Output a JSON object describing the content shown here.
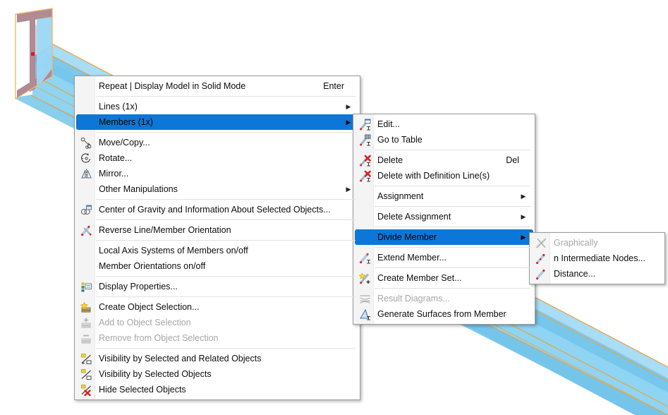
{
  "app": {
    "model_description": "3D structural model: blue I-beam member running diagonally with orange member outlines and a rose-colored I cross-section at the near end",
    "colors": {
      "highlight": "#0c77d8",
      "menu_background": "#ffffff",
      "gutter": "#f4f4f4",
      "separator": "#e2e2e2",
      "disabled_text": "#a6a6a6",
      "beam_face": "#8ed2f2",
      "beam_face_light": "#a9dcf5",
      "beam_face_dark": "#6ec0e8",
      "beam_edge": "#e8a33d",
      "section_fill": "#b08a94",
      "node_dot": "#e01b1b"
    }
  },
  "context_menu": {
    "items": [
      {
        "label": "Repeat | Display Model in Solid Mode",
        "accel": "Enter",
        "icon": "none",
        "submenu": false,
        "disabled": false,
        "selected": false
      },
      {
        "separator": true
      },
      {
        "label": "Lines (1x)",
        "accel": "",
        "icon": "none",
        "submenu": true,
        "disabled": false,
        "selected": false
      },
      {
        "label": "Members (1x)",
        "accel": "",
        "icon": "none",
        "submenu": true,
        "disabled": false,
        "selected": true
      },
      {
        "separator": true
      },
      {
        "label": "Move/Copy...",
        "accel": "",
        "icon": "move-copy-icon",
        "submenu": false,
        "disabled": false,
        "selected": false
      },
      {
        "label": "Rotate...",
        "accel": "",
        "icon": "rotate-icon",
        "submenu": false,
        "disabled": false,
        "selected": false
      },
      {
        "label": "Mirror...",
        "accel": "",
        "icon": "mirror-icon",
        "submenu": false,
        "disabled": false,
        "selected": false
      },
      {
        "label": "Other Manipulations",
        "accel": "",
        "icon": "none",
        "submenu": true,
        "disabled": false,
        "selected": false
      },
      {
        "separator": true
      },
      {
        "label": "Center of Gravity and Information About Selected Objects...",
        "accel": "",
        "icon": "center-of-gravity-icon",
        "submenu": false,
        "disabled": false,
        "selected": false
      },
      {
        "separator": true
      },
      {
        "label": "Reverse Line/Member Orientation",
        "accel": "",
        "icon": "reverse-orientation-icon",
        "submenu": false,
        "disabled": false,
        "selected": false
      },
      {
        "separator": true
      },
      {
        "label": "Local Axis Systems of Members on/off",
        "accel": "",
        "icon": "none",
        "submenu": false,
        "disabled": false,
        "selected": false
      },
      {
        "label": "Member Orientations on/off",
        "accel": "",
        "icon": "none",
        "submenu": false,
        "disabled": false,
        "selected": false
      },
      {
        "separator": true
      },
      {
        "label": "Display Properties...",
        "accel": "",
        "icon": "display-properties-icon",
        "submenu": false,
        "disabled": false,
        "selected": false
      },
      {
        "separator": true
      },
      {
        "label": "Create Object Selection...",
        "accel": "",
        "icon": "create-object-selection-icon",
        "submenu": false,
        "disabled": false,
        "selected": false
      },
      {
        "label": "Add to Object Selection",
        "accel": "",
        "icon": "add-to-object-selection-icon",
        "submenu": false,
        "disabled": true,
        "selected": false
      },
      {
        "label": "Remove from Object Selection",
        "accel": "",
        "icon": "remove-from-object-selection-icon",
        "submenu": false,
        "disabled": true,
        "selected": false
      },
      {
        "separator": true
      },
      {
        "label": "Visibility by Selected and Related Objects",
        "accel": "",
        "icon": "visibility-related-icon",
        "submenu": false,
        "disabled": false,
        "selected": false
      },
      {
        "label": "Visibility by Selected Objects",
        "accel": "",
        "icon": "visibility-selected-icon",
        "submenu": false,
        "disabled": false,
        "selected": false
      },
      {
        "label": "Hide Selected Objects",
        "accel": "",
        "icon": "hide-selected-icon",
        "submenu": false,
        "disabled": false,
        "selected": false
      }
    ]
  },
  "members_submenu": {
    "items": [
      {
        "label": "Edit...",
        "accel": "",
        "icon": "member-edit-icon",
        "submenu": false,
        "disabled": false,
        "selected": false
      },
      {
        "label": "Go to Table",
        "accel": "",
        "icon": "member-table-icon",
        "submenu": false,
        "disabled": false,
        "selected": false
      },
      {
        "separator": true
      },
      {
        "label": "Delete",
        "accel": "Del",
        "icon": "member-delete-icon",
        "submenu": false,
        "disabled": false,
        "selected": false
      },
      {
        "label": "Delete with Definition Line(s)",
        "accel": "",
        "icon": "member-delete-line-icon",
        "submenu": false,
        "disabled": false,
        "selected": false
      },
      {
        "separator": true
      },
      {
        "label": "Assignment",
        "accel": "",
        "icon": "none",
        "submenu": true,
        "disabled": false,
        "selected": false
      },
      {
        "separator": true
      },
      {
        "label": "Delete Assignment",
        "accel": "",
        "icon": "none",
        "submenu": true,
        "disabled": false,
        "selected": false
      },
      {
        "separator": true
      },
      {
        "label": "Divide Member",
        "accel": "",
        "icon": "none",
        "submenu": true,
        "disabled": false,
        "selected": true
      },
      {
        "separator": true
      },
      {
        "label": "Extend Member...",
        "accel": "",
        "icon": "extend-member-icon",
        "submenu": false,
        "disabled": false,
        "selected": false
      },
      {
        "separator": true
      },
      {
        "label": "Create Member Set...",
        "accel": "",
        "icon": "create-member-set-icon",
        "submenu": false,
        "disabled": false,
        "selected": false
      },
      {
        "separator": true
      },
      {
        "label": "Result Diagrams...",
        "accel": "",
        "icon": "result-diagrams-icon",
        "submenu": false,
        "disabled": true,
        "selected": false
      },
      {
        "label": "Generate Surfaces from Member",
        "accel": "",
        "icon": "generate-surfaces-icon",
        "submenu": false,
        "disabled": false,
        "selected": false
      }
    ]
  },
  "divide_member_submenu": {
    "items": [
      {
        "label": "Graphically",
        "accel": "",
        "icon": "divide-graphically-icon",
        "submenu": false,
        "disabled": true,
        "selected": false
      },
      {
        "label": "n Intermediate Nodes...",
        "accel": "",
        "icon": "divide-nodes-icon",
        "submenu": false,
        "disabled": false,
        "selected": false
      },
      {
        "label": "Distance...",
        "accel": "",
        "icon": "divide-distance-icon",
        "submenu": false,
        "disabled": false,
        "selected": false
      }
    ]
  }
}
